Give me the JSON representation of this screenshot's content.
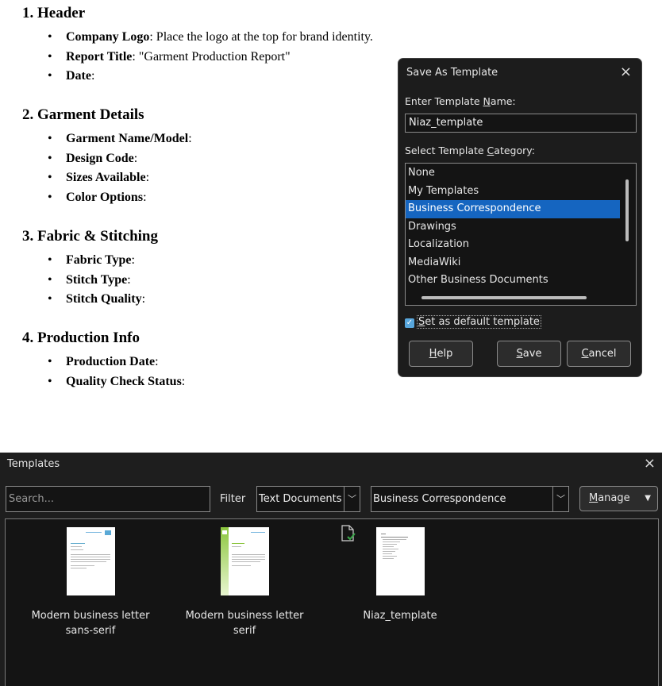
{
  "document": {
    "sections": [
      {
        "heading": "1. Header",
        "items": [
          {
            "label": "Company Logo",
            "text": ": Place the logo at the top for brand identity."
          },
          {
            "label": "Report Title",
            "text": ": \"Garment Production Report\""
          },
          {
            "label": "Date",
            "text": ":"
          }
        ]
      },
      {
        "heading": "2. Garment Details",
        "items": [
          {
            "label": "Garment Name/Model",
            "text": ":"
          },
          {
            "label": "Design Code",
            "text": ":"
          },
          {
            "label": "Sizes Available",
            "text": ":"
          },
          {
            "label": "Color Options",
            "text": ":"
          }
        ]
      },
      {
        "heading": "3. Fabric & Stitching",
        "items": [
          {
            "label": "Fabric Type",
            "text": ":"
          },
          {
            "label": "Stitch Type",
            "text": ":"
          },
          {
            "label": "Stitch Quality",
            "text": ":"
          }
        ]
      },
      {
        "heading": "4. Production Info",
        "items": [
          {
            "label": "Production Date",
            "text": ":"
          },
          {
            "label": "Quality Check Status",
            "text": ":"
          }
        ]
      }
    ]
  },
  "save_dialog": {
    "title": "Save As Template",
    "close_icon": "×",
    "name_label_pre": "Enter Template ",
    "name_label_key": "N",
    "name_label_post": "ame:",
    "name_value": "Niaz_template",
    "category_label_pre": "Select Template ",
    "category_label_key": "C",
    "category_label_post": "ategory:",
    "categories": [
      "None",
      "My Templates",
      "Business Correspondence",
      "Drawings",
      "Localization",
      "MediaWiki",
      "Other Business Documents"
    ],
    "selected_category": "Business Correspondence",
    "default_checkbox_checked": true,
    "default_label_key": "S",
    "default_label_rest": "et as default template",
    "help_key": "H",
    "help_rest": "elp",
    "save_key": "S",
    "save_rest": "ave",
    "cancel_key": "C",
    "cancel_rest": "ancel",
    "accent_color": "#1565c0"
  },
  "templates_window": {
    "title": "Templates",
    "close_icon": "×",
    "search_placeholder": "Search...",
    "filter_label": "Filter",
    "filter_value": "Text Documents",
    "category_value": "Business Correspondence",
    "manage_key": "M",
    "manage_rest": "anage",
    "templates": [
      {
        "name_line1": "Modern business letter",
        "name_line2": "sans-serif"
      },
      {
        "name_line1": "Modern business letter",
        "name_line2": "serif"
      },
      {
        "name_line1": "Niaz_template",
        "name_line2": "",
        "icon": "default-template-check-icon"
      }
    ]
  }
}
